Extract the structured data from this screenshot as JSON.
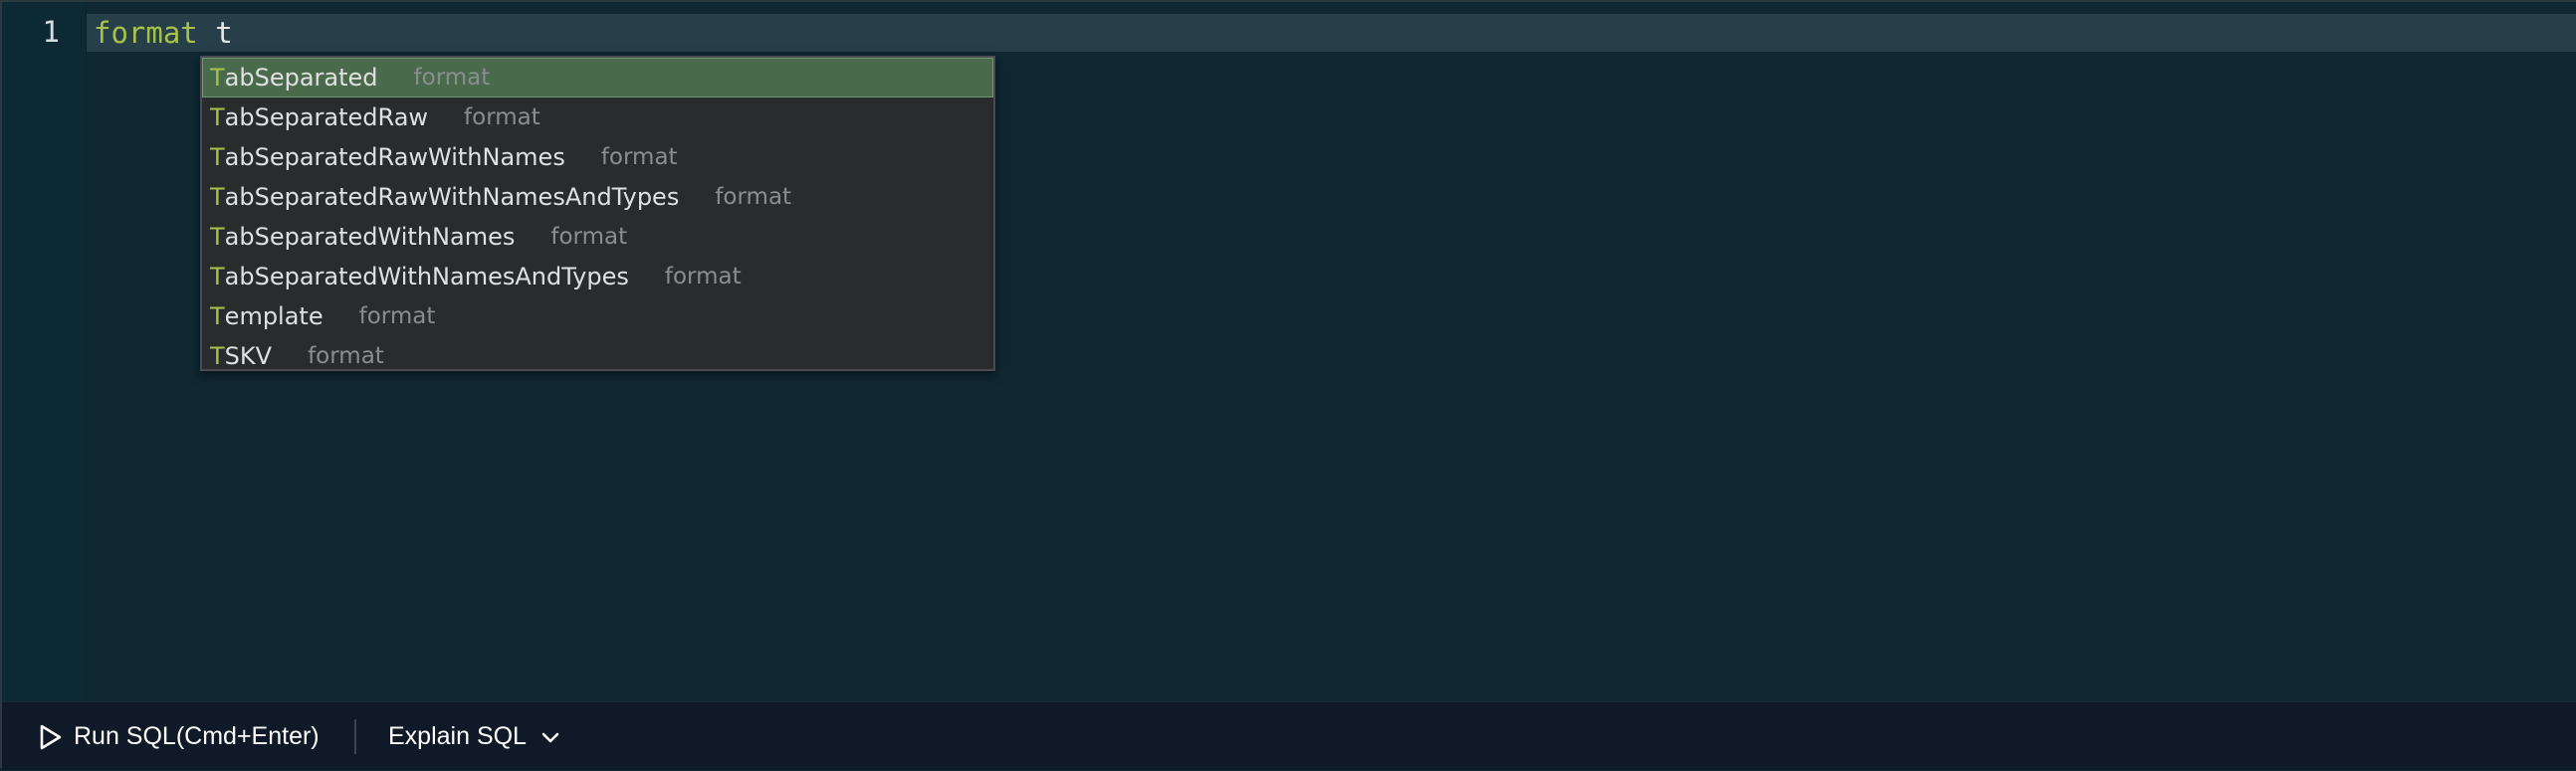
{
  "editor": {
    "line_numbers": [
      "1"
    ],
    "code": {
      "keyword": "format",
      "identifier": "t"
    }
  },
  "suggestions": {
    "items": [
      {
        "match": "T",
        "rest": "abSeparated",
        "detail": "format",
        "selected": true
      },
      {
        "match": "T",
        "rest": "abSeparatedRaw",
        "detail": "format",
        "selected": false
      },
      {
        "match": "T",
        "rest": "abSeparatedRawWithNames",
        "detail": "format",
        "selected": false
      },
      {
        "match": "T",
        "rest": "abSeparatedRawWithNamesAndTypes",
        "detail": "format",
        "selected": false
      },
      {
        "match": "T",
        "rest": "abSeparatedWithNames",
        "detail": "format",
        "selected": false
      },
      {
        "match": "T",
        "rest": "abSeparatedWithNamesAndTypes",
        "detail": "format",
        "selected": false
      },
      {
        "match": "T",
        "rest": "emplate",
        "detail": "format",
        "selected": false
      },
      {
        "match": "T",
        "rest": "SKV",
        "detail": "format",
        "selected": false
      }
    ]
  },
  "toolbar": {
    "run_label": "Run SQL(Cmd+Enter)",
    "run_icon": "play-icon",
    "explain_label": "Explain SQL",
    "explain_icon": "chevron-down-icon"
  },
  "colors": {
    "editor_bg": "#0f2832",
    "keyword": "#a6c24a",
    "selection": "#4a6b4b",
    "toolbar_bg": "#101927"
  }
}
